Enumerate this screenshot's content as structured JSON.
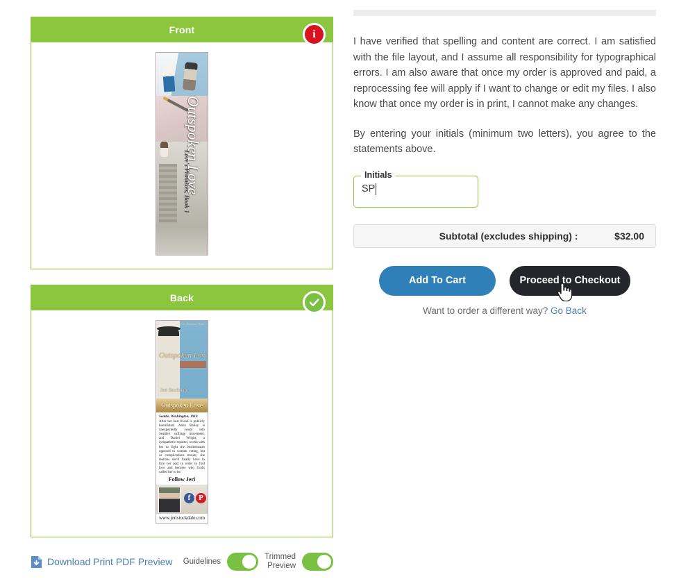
{
  "left": {
    "front_panel": {
      "header": "Front",
      "badge": {
        "icon": "info-icon",
        "glyph": "i",
        "color": "#d9121f"
      },
      "artwork": {
        "title": "Outspoken Love",
        "subtitle": "Love's Promises, Book 1"
      }
    },
    "back_panel": {
      "header": "Back",
      "badge": {
        "icon": "check-circle-icon",
        "color": "#7ac143"
      },
      "artwork": {
        "series": "Love's Promises, Book 1",
        "cover_title": "Outspoken Love",
        "author": "Jeri Stockdale",
        "band_title": "Outspoken Love",
        "location": "Seattle, Washington, 1910",
        "blurb": "After her best friend is publicly humiliated, Anna Bailey is unexpectedly swept into Seattle's suffrage movement, and Daniel Wright, a sympathetic reporter, works with her to fight the businessman opposed to women voting, but as complications mount, she realizes she'll finally have to face her past in order to find love and become who God's called her to be.",
        "follow": "Follow Jeri",
        "social": [
          {
            "name": "facebook-icon",
            "glyph": "f",
            "color": "#3b5998"
          },
          {
            "name": "pinterest-icon",
            "glyph": "P",
            "color": "#cb2027"
          }
        ],
        "url": "www.jeristockdale.com"
      }
    },
    "toolbar": {
      "download_label": "Download Print PDF Preview",
      "download_icon": "file-download-icon",
      "guidelines_label": "Guidelines",
      "guidelines_on": true,
      "trimmed_label_line1": "Trimmed",
      "trimmed_label_line2": "Preview",
      "trimmed_on": true
    }
  },
  "right": {
    "agreement_paragraph_1": "I have verified that spelling and content are correct. I am satisfied with the file layout, and I assume all responsibility for typographical errors. I am also aware that once my order is approved and paid, a reprocessing fee will apply if I want to change or edit my files. I also know that once my order is in print, I cannot make any changes.",
    "agreement_paragraph_2": "By entering your initials (minimum two letters), you agree to the statements above.",
    "initials": {
      "legend": "Initials",
      "value": "SP",
      "placeholder": ""
    },
    "subtotal": {
      "label": "Subtotal (excludes shipping) :",
      "value": "$32.00"
    },
    "buttons": {
      "add_to_cart": "Add To Cart",
      "proceed_to_checkout": "Proceed to Checkout"
    },
    "footer": {
      "question": "Want to order a different way?",
      "link": "Go Back"
    }
  },
  "colors": {
    "green": "#8cc63f",
    "blue": "#2f80b8",
    "dark": "#24262b",
    "red": "#d9121f",
    "link": "#4a7fb5"
  }
}
